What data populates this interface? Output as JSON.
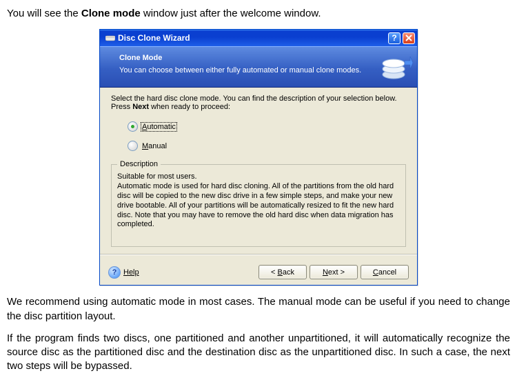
{
  "doc": {
    "p1_pre": "You will see the ",
    "p1_bold": "Clone mode",
    "p1_post": " window just after the welcome window.",
    "p2": "We recommend using automatic mode in most cases. The manual mode can be useful if you need to change the disc partition layout.",
    "p3": "If the program finds two discs, one partitioned and another unpartitioned, it will automatically recognize the source disc as the partitioned disc and the destination disc as the unpartitioned disc. In such a case, the next two steps will be bypassed."
  },
  "wizard": {
    "title": "Disc Clone Wizard",
    "banner_title": "Clone Mode",
    "banner_sub": "You can choose between either fully automated or manual clone modes.",
    "instruct_pre": "Select the hard disc clone mode. You can find the description of your selection below. Press ",
    "instruct_bold": "Next",
    "instruct_post": " when ready to proceed:",
    "options": {
      "auto": "Automatic",
      "manual": "Manual"
    },
    "desc_legend": "Description",
    "desc_line1": "Suitable for most users.",
    "desc_body": "Automatic mode is used for hard disc cloning. All of the partitions from the old hard disc will be copied to the new disc drive in a few simple steps, and make your new drive bootable. All of your partitions will be automatically resized to fit the new hard disc. Note that you may have to remove the old hard disc when data migration has completed.",
    "help": "Help",
    "back": "Back",
    "next": "Next",
    "cancel": "Cancel"
  }
}
